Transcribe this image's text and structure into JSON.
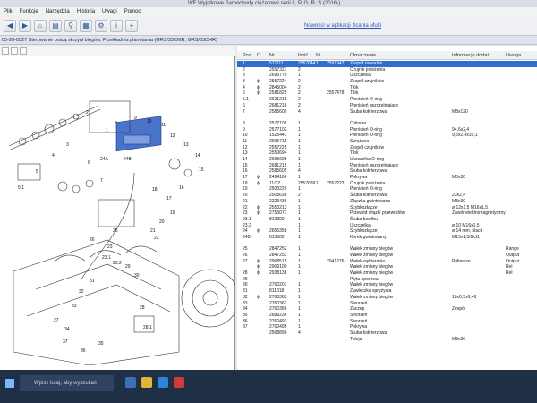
{
  "window": {
    "title": "WF Wyjątkowe Samochody ciężarowe serii L, P, G, R, S (2016-)"
  },
  "menu": [
    "Plik",
    "Funkcje",
    "Narzędzia",
    "Historia",
    "Uwagi",
    "Pomoc"
  ],
  "toolbar": {
    "notice_link": "Nowości w aplikacji Scania Multi"
  },
  "breadcrumb": "05-20-0327 Sterowanie pracą skrzyni biegów, Przekładnia planetarna (GRS/33CMR, GRS/33CHR)",
  "table": {
    "headers": [
      "Poz",
      "O",
      "Nr",
      "Ilość",
      "N",
      "Oznaczenie",
      "Informacje dodat.",
      "Uwaga"
    ],
    "rows": [
      {
        "pos": "1",
        "mark": "",
        "nr": "571111",
        "qty": "2567844",
        "n": "1",
        "ref": "2591947",
        "name": "Zespół zaworów",
        "info": "",
        "note": "",
        "selected": true
      },
      {
        "pos": "2",
        "mark": "",
        "nr": "2557327",
        "qty": "2",
        "n": "",
        "ref": "",
        "name": "Czujnik położenia",
        "info": "",
        "note": ""
      },
      {
        "pos": "3",
        "mark": "",
        "nr": "2695770",
        "qty": "1",
        "n": "",
        "ref": "",
        "name": "Uszczelka",
        "info": "",
        "note": ""
      },
      {
        "pos": "3",
        "mark": "ϕ",
        "nr": "2557224",
        "qty": "2",
        "n": "",
        "ref": "",
        "name": "Zespół czujników",
        "info": "",
        "note": ""
      },
      {
        "pos": "4",
        "mark": "ϕ",
        "nr": "2845004",
        "qty": "2",
        "n": "",
        "ref": "",
        "name": "Tłok",
        "info": "",
        "note": ""
      },
      {
        "pos": "5",
        "mark": "ϕ",
        "nr": "2581825",
        "qty": "2",
        "n": "",
        "ref": "2557478",
        "name": "Tłok",
        "info": "",
        "note": ""
      },
      {
        "pos": "5.1",
        "mark": "",
        "nr": "2621211",
        "qty": "2",
        "n": "",
        "ref": "",
        "name": "Pierścień O-ring",
        "info": "",
        "note": ""
      },
      {
        "pos": "6",
        "mark": "",
        "nr": "2681218",
        "qty": "2",
        "n": "",
        "ref": "",
        "name": "Pierścień uszczelniający",
        "info": "",
        "note": ""
      },
      {
        "pos": "7",
        "mark": "",
        "nr": "2585609",
        "qty": "4",
        "n": "",
        "ref": "",
        "name": "Śruba kołnierzowa",
        "info": "M8x120",
        "note": ""
      },
      {
        "pos": "",
        "mark": "",
        "nr": "",
        "qty": "",
        "n": "",
        "ref": "",
        "name": "",
        "info": "",
        "note": ""
      },
      {
        "pos": "8",
        "mark": "",
        "nr": "2577105",
        "qty": "1",
        "n": "",
        "ref": "",
        "name": "Cylinder",
        "info": "",
        "note": ""
      },
      {
        "pos": "9",
        "mark": "",
        "nr": "2577102",
        "qty": "1",
        "n": "",
        "ref": "",
        "name": "Pierścień O-ring",
        "info": "94,6x2,4",
        "note": ""
      },
      {
        "pos": "10",
        "mark": "",
        "nr": "1525441",
        "qty": "1",
        "n": "",
        "ref": "",
        "name": "Pierścień O-ring",
        "info": "9,5x2,4x10,1",
        "note": ""
      },
      {
        "pos": "11",
        "mark": "",
        "nr": "2695711",
        "qty": "1",
        "n": "",
        "ref": "",
        "name": "Sprężyna",
        "info": "",
        "note": ""
      },
      {
        "pos": "12",
        "mark": "",
        "nr": "2557225",
        "qty": "1",
        "n": "",
        "ref": "",
        "name": "Zespół czujników",
        "info": "",
        "note": ""
      },
      {
        "pos": "13",
        "mark": "",
        "nr": "2550694",
        "qty": "1",
        "n": "",
        "ref": "",
        "name": "Tłok",
        "info": "",
        "note": ""
      },
      {
        "pos": "14",
        "mark": "",
        "nr": "2695695",
        "qty": "1",
        "n": "",
        "ref": "",
        "name": "Uszczelka O-ring",
        "info": "",
        "note": ""
      },
      {
        "pos": "15",
        "mark": "",
        "nr": "2681215",
        "qty": "1",
        "n": "",
        "ref": "",
        "name": "Pierścień uszczelniający",
        "info": "",
        "note": ""
      },
      {
        "pos": "16",
        "mark": "",
        "nr": "2585605",
        "qty": "4",
        "n": "",
        "ref": "",
        "name": "Śruba kołnierzowa",
        "info": "",
        "note": ""
      },
      {
        "pos": "17",
        "mark": "ϕ",
        "nr": "2494166",
        "qty": "1",
        "n": "",
        "ref": "",
        "name": "Pokrywa",
        "info": "M8x30",
        "note": ""
      },
      {
        "pos": "18",
        "mark": "ϕ",
        "nr": "11/12",
        "qty": "2557639",
        "n": "1",
        "ref": "2557222",
        "name": "Czujnik położenia",
        "info": "",
        "note": ""
      },
      {
        "pos": "19",
        "mark": "",
        "nr": "2503229",
        "qty": "1",
        "n": "",
        "ref": "",
        "name": "Pierścień O-ring",
        "info": "",
        "note": ""
      },
      {
        "pos": "20",
        "mark": "",
        "nr": "2505636",
        "qty": "2",
        "n": "",
        "ref": "",
        "name": "Śruba kołnierzowa",
        "info": "23x2,4",
        "note": ""
      },
      {
        "pos": "21",
        "mark": "",
        "nr": "2223436",
        "qty": "1",
        "n": "",
        "ref": "",
        "name": "Złączka gwintowana",
        "info": "M8x30",
        "note": ""
      },
      {
        "pos": "22",
        "mark": "ϕ",
        "nr": "2550213",
        "qty": "1",
        "n": "",
        "ref": "",
        "name": "Szybkozłącze",
        "info": "ø 12x1,5 M16x1,5",
        "note": ""
      },
      {
        "pos": "23",
        "mark": "ϕ",
        "nr": "2755071",
        "qty": "1",
        "n": "",
        "ref": "",
        "name": "Przewód wiązki przewodów",
        "info": "Zawór elektromagnetyczny",
        "note": ""
      },
      {
        "pos": "23.1",
        "mark": "",
        "nr": "812390",
        "qty": "1",
        "n": "",
        "ref": "",
        "name": "Śruba bez łbu",
        "info": "",
        "note": ""
      },
      {
        "pos": "23.2",
        "mark": "",
        "nr": "",
        "qty": "1",
        "n": "",
        "ref": "",
        "name": "Uszczelka",
        "info": "ø 10 M16x1,5",
        "note": ""
      },
      {
        "pos": "24",
        "mark": "ϕ",
        "nr": "2655358",
        "qty": "1",
        "n": "",
        "ref": "",
        "name": "Szybkozłącze",
        "info": "ø 14 mm, black",
        "note": ""
      },
      {
        "pos": "24B",
        "mark": "",
        "nr": "813302",
        "qty": "1",
        "n": "",
        "ref": "",
        "name": "Korek gwintowany",
        "info": "M13x1,5/8x11",
        "note": ""
      },
      {
        "pos": "",
        "mark": "",
        "nr": "",
        "qty": "",
        "n": "",
        "ref": "",
        "name": "",
        "info": "",
        "note": ""
      },
      {
        "pos": "25",
        "mark": "",
        "nr": "2847252",
        "qty": "1",
        "n": "",
        "ref": "",
        "name": "Wałek zmiany biegów",
        "info": "",
        "note": "Range"
      },
      {
        "pos": "26",
        "mark": "",
        "nr": "2847253",
        "qty": "1",
        "n": "",
        "ref": "",
        "name": "Wałek zmiany biegów",
        "info": "",
        "note": "Output"
      },
      {
        "pos": "27",
        "mark": "ϕ",
        "nr": "2968515",
        "qty": "1",
        "n": "",
        "ref": "2041276",
        "name": "Wałek wybierania",
        "info": "Półtarcze",
        "note": "Output"
      },
      {
        "pos": "",
        "mark": "ϕ",
        "nr": "2909100",
        "qty": "1",
        "n": "",
        "ref": "",
        "name": "Wałek zmiany biegów",
        "info": "",
        "note": "Rel"
      },
      {
        "pos": "28",
        "mark": "ϕ",
        "nr": "2938138",
        "qty": "1",
        "n": "",
        "ref": "",
        "name": "Wałek zmiany biegów",
        "info": "",
        "note": "Rel"
      },
      {
        "pos": "29",
        "mark": "",
        "nr": "",
        "qty": "",
        "n": "",
        "ref": "",
        "name": "Płyta oporowa",
        "info": "",
        "note": ""
      },
      {
        "pos": "30",
        "mark": "",
        "nr": "2760207",
        "qty": "1",
        "n": "",
        "ref": "",
        "name": "Wałek zmiany biegów",
        "info": "",
        "note": ""
      },
      {
        "pos": "31",
        "mark": "",
        "nr": "811818",
        "qty": "1",
        "n": "",
        "ref": "",
        "name": "Zawleczka sprężysta",
        "info": "",
        "note": ""
      },
      {
        "pos": "32",
        "mark": "ϕ",
        "nr": "2760363",
        "qty": "1",
        "n": "",
        "ref": "",
        "name": "Wałek zmiany biegów",
        "info": "10x0,5x6,46",
        "note": ""
      },
      {
        "pos": "33",
        "mark": "",
        "nr": "2760362",
        "qty": "1",
        "n": "",
        "ref": "",
        "name": "Sworzeń",
        "info": "",
        "note": ""
      },
      {
        "pos": "34",
        "mark": "",
        "nr": "2760366",
        "qty": "1",
        "n": "",
        "ref": "",
        "name": "Zaczep",
        "info": "Zespół",
        "note": ""
      },
      {
        "pos": "35",
        "mark": "",
        "nr": "2689236",
        "qty": "1",
        "n": "",
        "ref": "",
        "name": "Sworzeń",
        "info": "",
        "note": ""
      },
      {
        "pos": "36",
        "mark": "",
        "nr": "2760493",
        "qty": "1",
        "n": "",
        "ref": "",
        "name": "Sworzeń",
        "info": "",
        "note": ""
      },
      {
        "pos": "37",
        "mark": "",
        "nr": "2760495",
        "qty": "1",
        "n": "",
        "ref": "",
        "name": "Pokrywa",
        "info": "",
        "note": ""
      },
      {
        "pos": "",
        "mark": "",
        "nr": "2568896",
        "qty": "4",
        "n": "",
        "ref": "",
        "name": "Śruba kołnierzowa",
        "info": "",
        "note": ""
      },
      {
        "pos": "",
        "mark": "",
        "nr": "",
        "qty": "",
        "n": "",
        "ref": "",
        "name": "Tuleja",
        "info": "M8x30",
        "note": ""
      }
    ]
  },
  "diagram": {
    "labels": [
      "1",
      "2",
      "3",
      "4",
      "5",
      "5.1",
      "6",
      "7",
      "8",
      "9",
      "10",
      "11",
      "12",
      "13",
      "14",
      "15",
      "16",
      "17",
      "18",
      "19",
      "20",
      "21",
      "22",
      "23",
      "23.1",
      "23.2",
      "24A",
      "24B",
      "25",
      "26",
      "27",
      "28",
      "28.1",
      "29",
      "30",
      "31",
      "32",
      "33",
      "34",
      "35",
      "36",
      "37"
    ]
  },
  "taskbar": {
    "search_placeholder": "Wpisz tutaj, aby wyszukać"
  },
  "colors": {
    "selection": "#2d6fd1",
    "diagram_highlight": "#4a74c9"
  }
}
